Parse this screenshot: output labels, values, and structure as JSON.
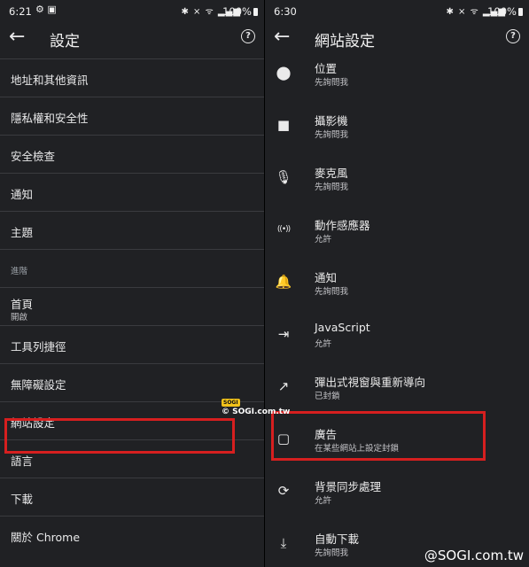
{
  "left": {
    "status": {
      "time": "6:21",
      "notif": "⚙ ▣",
      "signals": "✱ ⨯ ᯤ ▂▄▆",
      "battery": "100%"
    },
    "title": "設定",
    "rows": [
      {
        "label": "地址和其他資訊"
      },
      {
        "label": "隱私權和安全性"
      },
      {
        "label": "安全檢查"
      },
      {
        "label": "通知"
      },
      {
        "label": "主題"
      },
      {
        "label": "進階",
        "section": true
      },
      {
        "label": "首頁",
        "sub": "開啟"
      },
      {
        "label": "工具列捷徑"
      },
      {
        "label": "無障礙設定"
      },
      {
        "label": "網站設定"
      },
      {
        "label": "語言"
      },
      {
        "label": "下載"
      },
      {
        "label": "關於 Chrome"
      }
    ]
  },
  "right": {
    "status": {
      "time": "6:30",
      "signals": "✱ ⨯ ᯤ ▂▄▆",
      "battery": "100%"
    },
    "title": "網站設定",
    "rows": [
      {
        "icon": "location-icon",
        "glyph": "⬤",
        "label": "位置",
        "sub": "先詢問我"
      },
      {
        "icon": "camera-icon",
        "glyph": "■",
        "label": "攝影機",
        "sub": "先詢問我"
      },
      {
        "icon": "microphone-icon",
        "glyph": "🎙",
        "label": "麥克風",
        "sub": "先詢問我"
      },
      {
        "icon": "motion-sensor-icon",
        "glyph": "((•))",
        "label": "動作感應器",
        "sub": "允許"
      },
      {
        "icon": "bell-icon",
        "glyph": "🔔",
        "label": "通知",
        "sub": "先詢問我"
      },
      {
        "icon": "javascript-icon",
        "glyph": "⇥",
        "label": "JavaScript",
        "sub": "允許"
      },
      {
        "icon": "popup-icon",
        "glyph": "↗",
        "label": "彈出式視窗與重新導向",
        "sub": "已封鎖"
      },
      {
        "icon": "ads-icon",
        "glyph": "▢",
        "label": "廣告",
        "sub": "在某些網站上設定封鎖"
      },
      {
        "icon": "sync-icon",
        "glyph": "⟳",
        "label": "背景同步處理",
        "sub": "允許"
      },
      {
        "icon": "download-icon",
        "glyph": "⤓",
        "label": "自動下載",
        "sub": "先詢問我"
      }
    ]
  },
  "watermark": {
    "mid": "© SOGI.com.tw",
    "sticker": "SOGI",
    "bottom": "@SOGI.com.tw"
  }
}
